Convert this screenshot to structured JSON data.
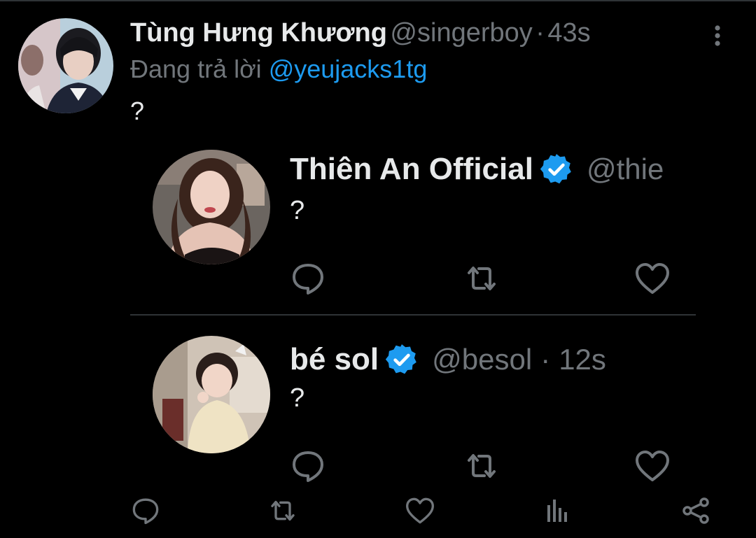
{
  "tweet": {
    "author_name": "Tùng Hưng Khương",
    "author_handle": "@singerboy",
    "separator": "·",
    "time": "43s",
    "reply_prefix": "Đang trả lời",
    "reply_to": "@yeujacks1tg",
    "text": "?"
  },
  "replies": [
    {
      "name": "Thiên An Official",
      "handle": "@thie",
      "verified": true,
      "text": "?"
    },
    {
      "name": "bé sol",
      "handle": "@besol",
      "separator": "·",
      "time": "12s",
      "verified": true,
      "text": "?"
    }
  ],
  "icons": {
    "reply": "reply-icon",
    "retweet": "retweet-icon",
    "like": "like-icon",
    "analytics": "analytics-icon",
    "share": "share-icon",
    "more": "more-icon",
    "verified": "verified-badge-icon"
  },
  "colors": {
    "background": "#000000",
    "text_primary": "#e7e9ea",
    "text_secondary": "#71767b",
    "accent": "#1d9bf0",
    "divider": "#2f3336"
  }
}
